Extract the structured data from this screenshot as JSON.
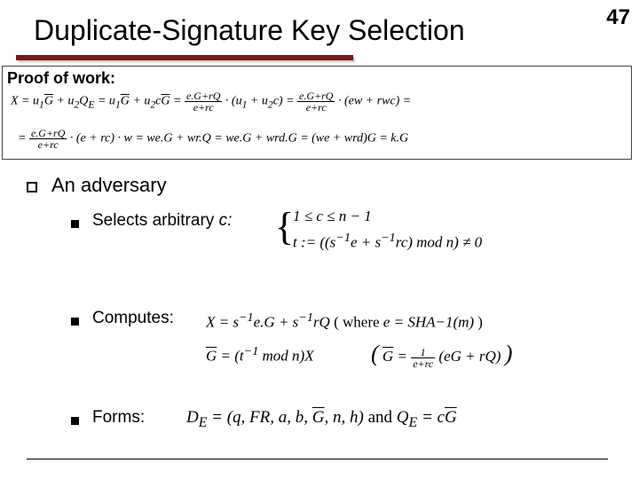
{
  "page_number": "47",
  "title": "Duplicate-Signature Key Selection",
  "proof_label": "Proof of work:",
  "proof_line1": "X = u₁G̅ + u₂Q_E = u₁G̅ + u₂cG̅ = (e.G+rQ)/(e+rc) · (u₁ + u₂c) = (e.G+rQ)/(e+rc) · (ew + rwc) =",
  "proof_line2": "= (e.G+rQ)/(e+rc) · (e + rc) · w = we.G + wr.Q = we.G + wrd.G = (we + wrd)G = k.G",
  "adversary": "An adversary",
  "items": {
    "selects_label": "Selects arbitrary",
    "selects_c": "c:",
    "selects_math1": "1 ≤ c ≤ n − 1",
    "selects_math2": "t := ((s⁻¹e + s⁻¹rc) mod n) ≠ 0",
    "computes_label": "Computes:",
    "computes_math1": "X = s⁻¹e.G + s⁻¹rQ ( where e = SHA−1(m) )",
    "computes_math2a": "G̅ = (t⁻¹ mod n)X",
    "computes_math2b": "( G̅ = 1/(e+rc) (eG + rQ) )",
    "forms_label": "Forms:",
    "forms_math": "D_E = (q, FR, a, b, G̅, n, h) and Q_E = cG̅"
  }
}
